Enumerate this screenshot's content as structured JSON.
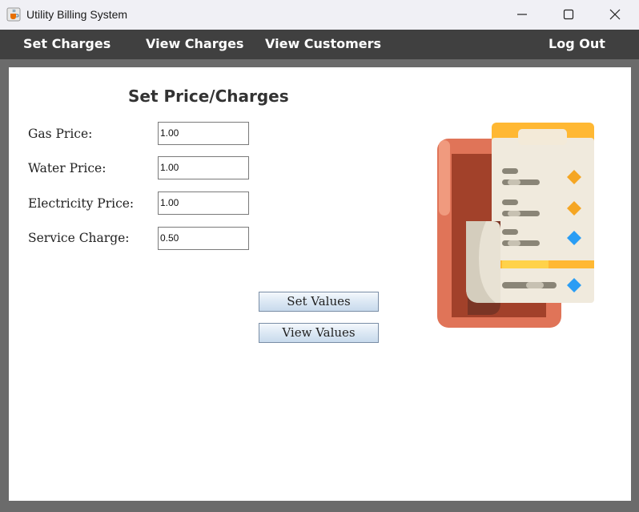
{
  "window": {
    "title": "Utility Billing System",
    "icon": "java-cup-icon",
    "controls": [
      "minimize-icon",
      "maximize-icon",
      "close-icon"
    ]
  },
  "menu": {
    "set_charges": "Set Charges",
    "view_charges": "View Charges",
    "view_customers": "View Customers",
    "log_out": "Log Out"
  },
  "form": {
    "heading": "Set Price/Charges",
    "gas_label": "Gas Price:",
    "gas_value": "1.00",
    "water_label": "Water Price:",
    "water_value": "1.00",
    "electricity_label": "Electricity Price:",
    "electricity_value": "1.00",
    "service_label": "Service Charge:",
    "service_value": "0.50",
    "set_button": "Set Values",
    "view_button": "View Values"
  },
  "illustration": {
    "icon": "bill-receipt-icon"
  },
  "colors": {
    "menubar": "#404040",
    "background": "#6b6b6b",
    "panel": "#ffffff",
    "receipt_yellow": "#ffb833",
    "receipt_red": "#e06a50",
    "accent_blue": "#2a9df4",
    "accent_orange": "#f5a623"
  }
}
